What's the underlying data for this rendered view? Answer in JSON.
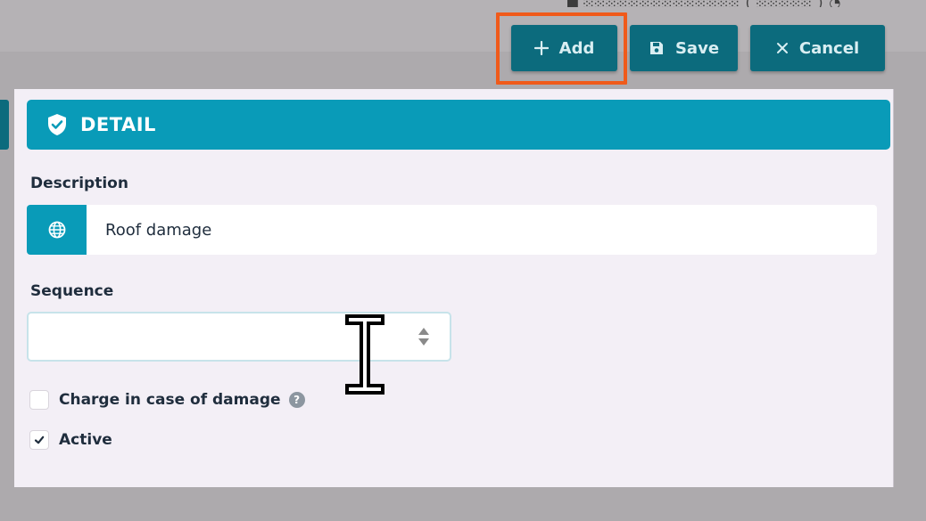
{
  "toolbar": {
    "add_label": "Add",
    "save_label": "Save",
    "cancel_label": "Cancel"
  },
  "panel": {
    "title": "DETAIL"
  },
  "form": {
    "description_label": "Description",
    "description_value": "Roof damage",
    "sequence_label": "Sequence",
    "sequence_value": "",
    "charge_label": "Charge in case of damage",
    "charge_checked": false,
    "active_label": "Active",
    "active_checked": true
  },
  "colors": {
    "accent": "#099bb8",
    "toolbar_button": "#0c6b7d",
    "highlight": "#f05a1a",
    "panel_bg": "#f3eff6"
  },
  "icons": {
    "add": "plus-icon",
    "save": "floppy-disk-icon",
    "cancel": "close-icon",
    "header": "shield-check-icon",
    "description": "globe-icon",
    "spinner": "spinner-arrows-icon",
    "help": "help-icon",
    "check": "checkmark-icon",
    "cursor": "text-cursor-icon"
  }
}
